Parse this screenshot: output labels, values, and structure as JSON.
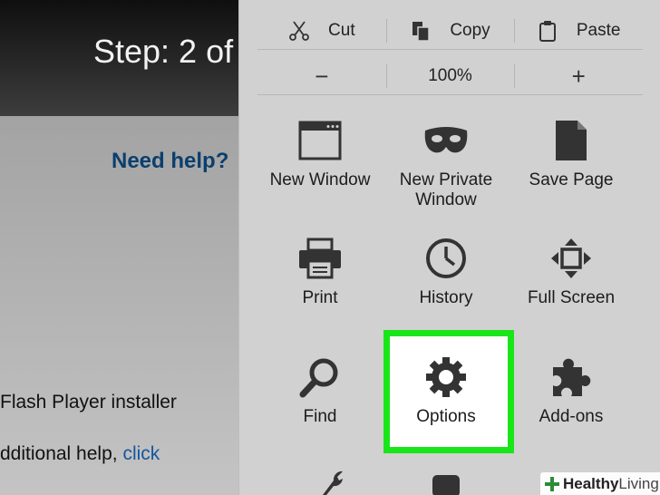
{
  "background": {
    "step_title": "Step: 2 of",
    "need_help": "Need help?",
    "line1": "Flash Player installer",
    "line2_prefix": "dditional help, ",
    "line2_link": "click"
  },
  "menu": {
    "edit": {
      "cut": "Cut",
      "copy": "Copy",
      "paste": "Paste"
    },
    "zoom": {
      "minus": "−",
      "level": "100%",
      "plus": "+"
    },
    "tiles": {
      "new_window": "New Window",
      "new_private_window_l1": "New Private",
      "new_private_window_l2": "Window",
      "save_page": "Save Page",
      "print": "Print",
      "history": "History",
      "full_screen": "Full Screen",
      "find": "Find",
      "options": "Options",
      "add_ons": "Add-ons"
    },
    "highlight_color": "#19e619"
  },
  "watermark": {
    "part1": "Healthy",
    "part2": " Living"
  }
}
